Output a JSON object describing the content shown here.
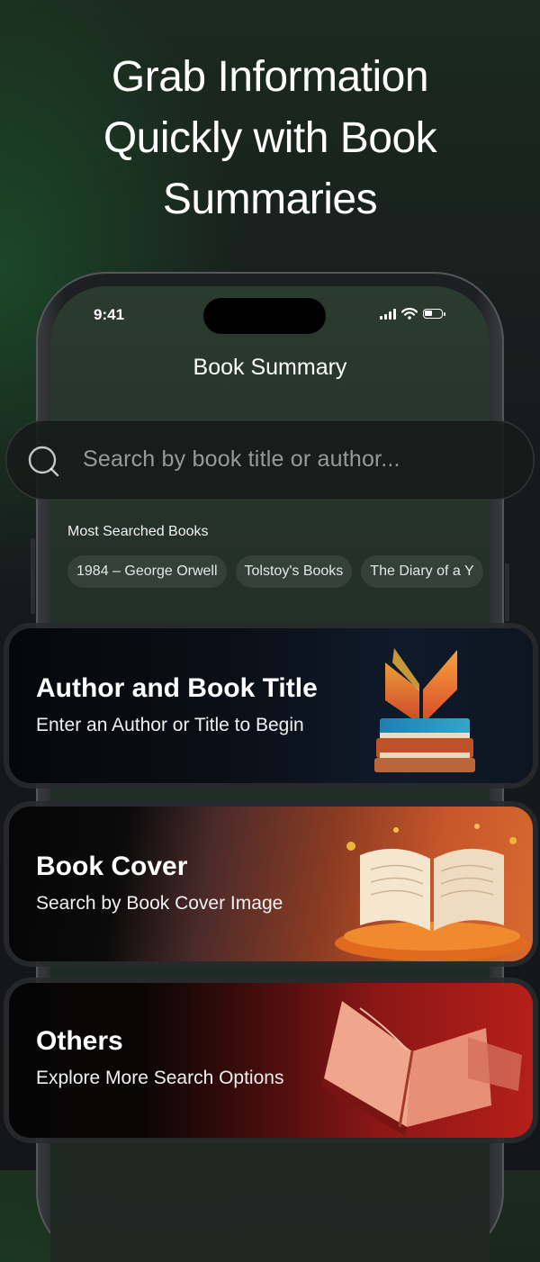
{
  "headline": {
    "line1": "Grab Information",
    "line2": "Quickly with Book",
    "line3": "Summaries"
  },
  "status_bar": {
    "time": "9:41"
  },
  "screen": {
    "title": "Book Summary",
    "search": {
      "placeholder": "Search by book title or author..."
    },
    "most_searched": {
      "title": "Most Searched Books",
      "chips": [
        "1984 – George Orwell",
        "Tolstoy's Books",
        "The Diary of a Y"
      ]
    }
  },
  "cards": [
    {
      "title": "Author and Book Title",
      "subtitle": "Enter an Author or Title to Begin"
    },
    {
      "title": "Book Cover",
      "subtitle": "Search by Book Cover Image"
    },
    {
      "title": "Others",
      "subtitle": "Explore More Search Options"
    }
  ],
  "icons": [
    "search-icon",
    "signal-icon",
    "wifi-icon",
    "battery-icon",
    "books-stack-icon",
    "open-book-icon",
    "flying-book-icon"
  ],
  "colors": {
    "accent_orange": "#e8742e",
    "accent_red": "#b51f1a",
    "text": "#ffffff"
  }
}
